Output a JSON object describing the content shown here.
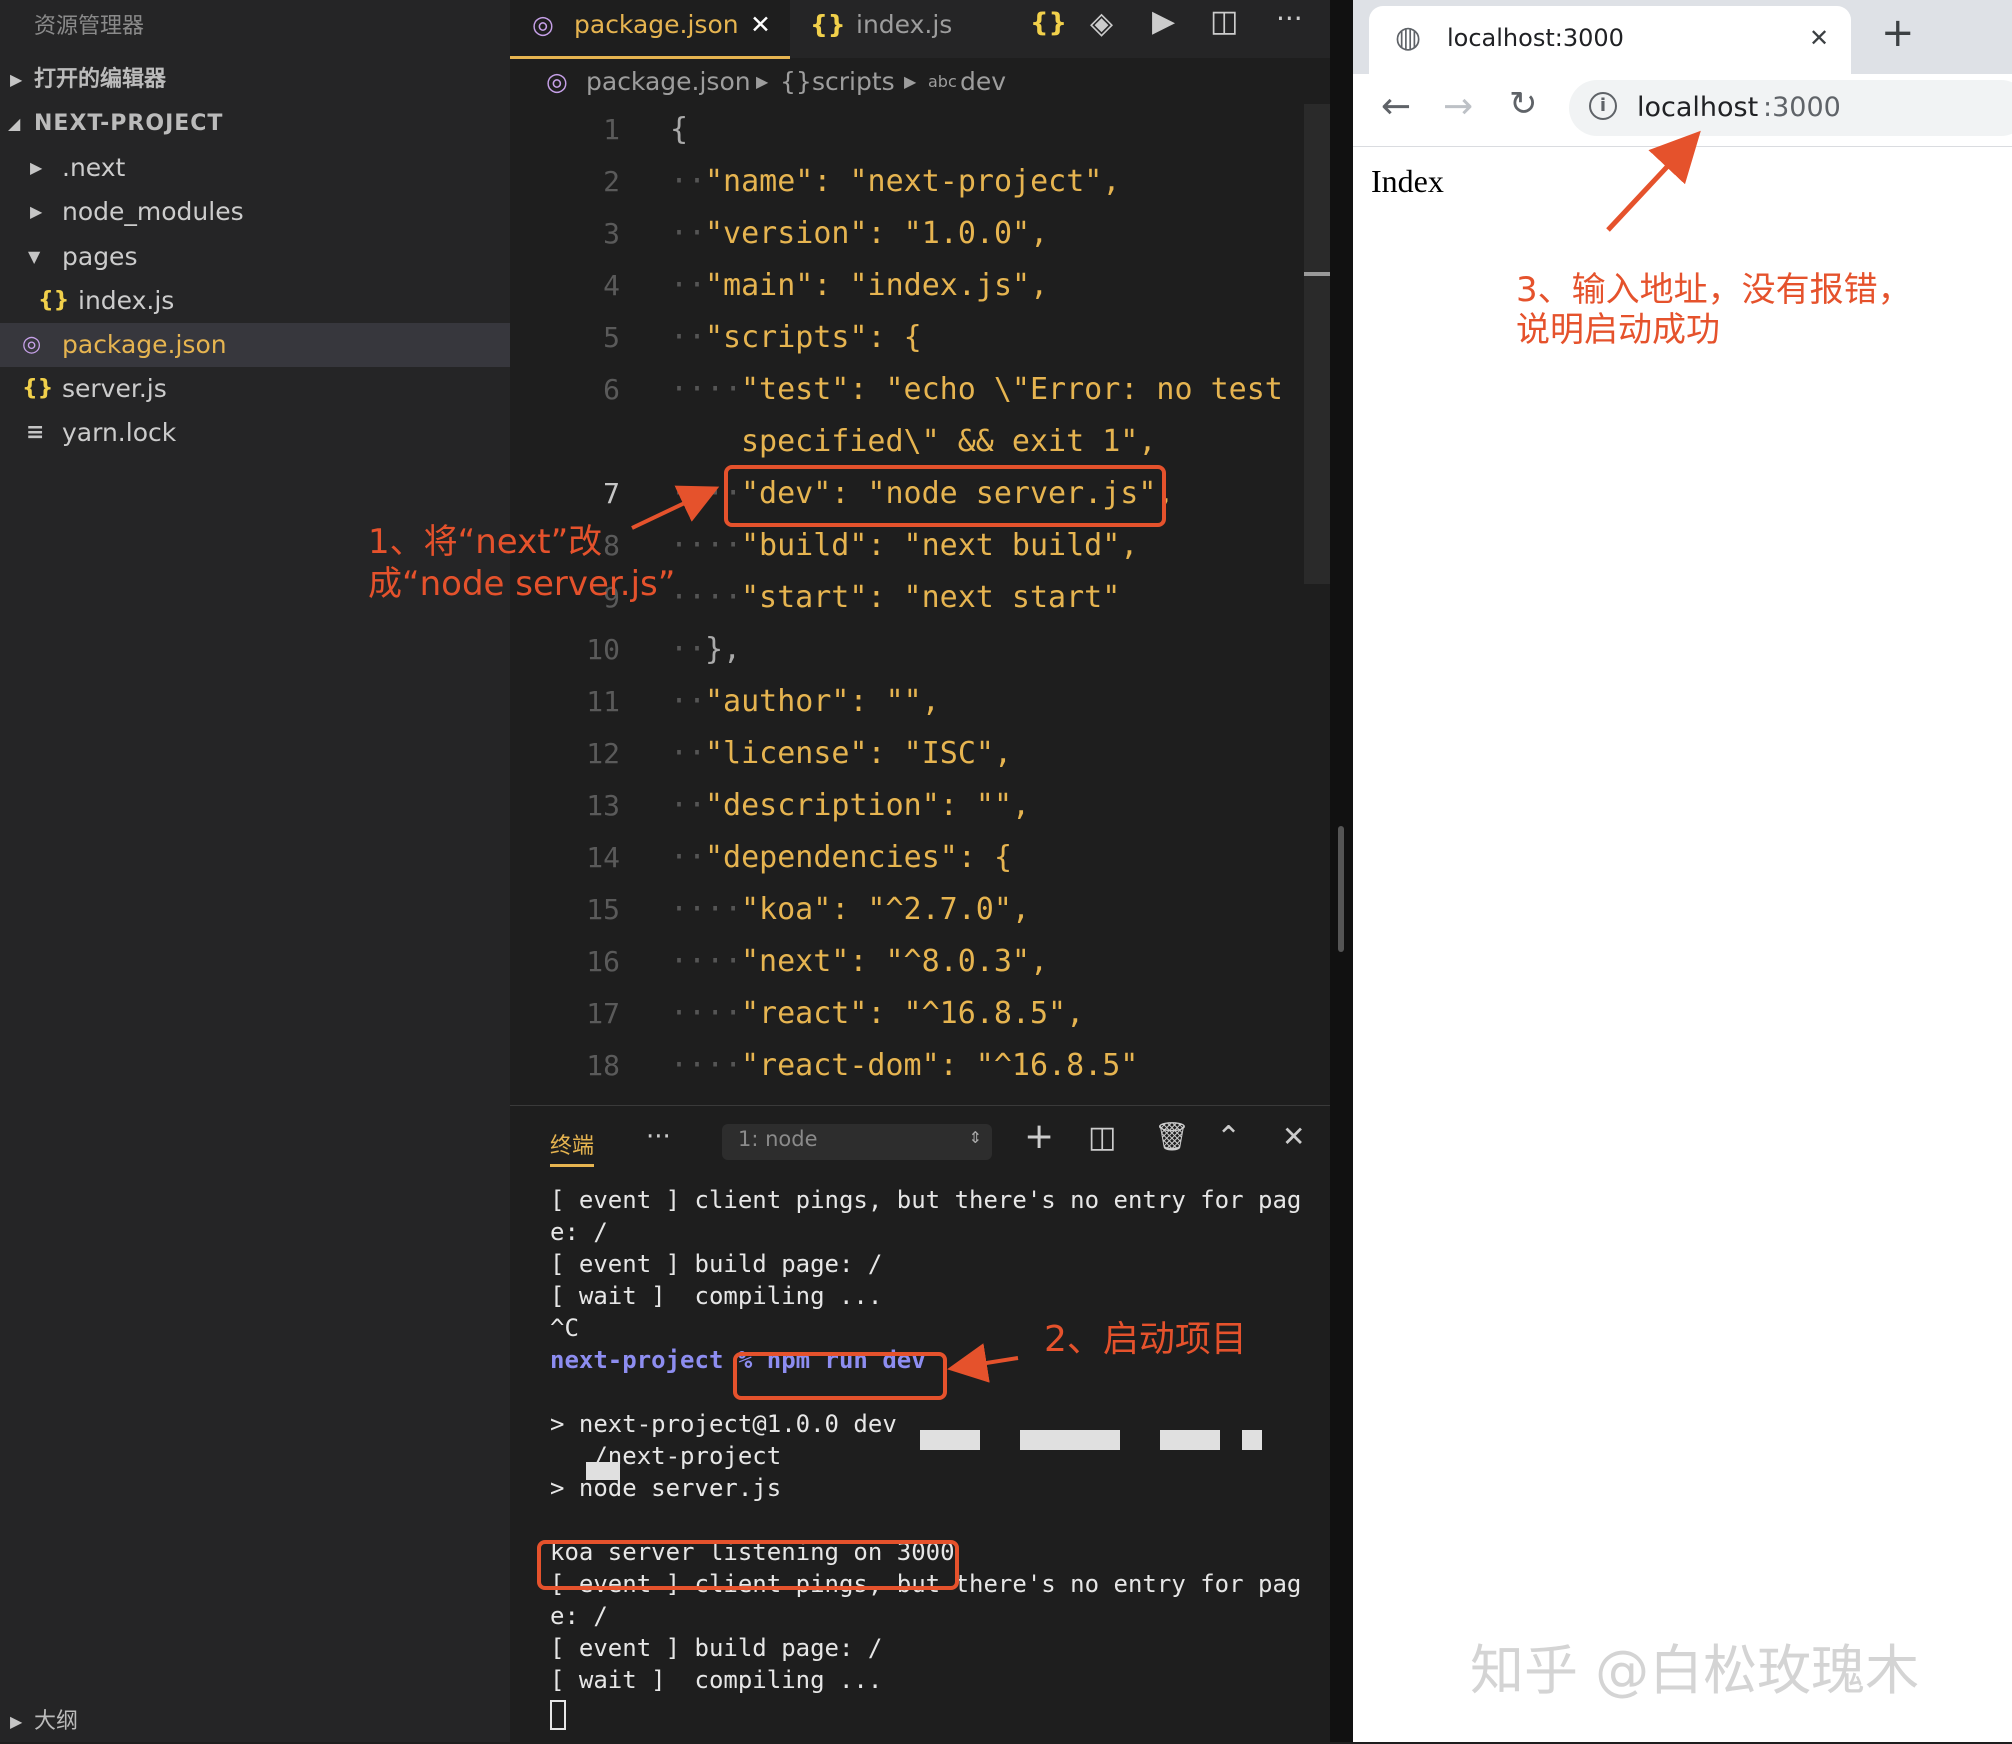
{
  "sidebar": {
    "title": "资源管理器",
    "open_editors": "打开的编辑器",
    "project": "NEXT-PROJECT",
    "items": [
      {
        "label": ".next",
        "type": "folder"
      },
      {
        "label": "node_modules",
        "type": "folder"
      },
      {
        "label": "pages",
        "type": "folder"
      },
      {
        "label": "index.js",
        "type": "file-js"
      },
      {
        "label": "package.json",
        "type": "file-json"
      },
      {
        "label": "server.js",
        "type": "file-js"
      },
      {
        "label": "yarn.lock",
        "type": "file-lock"
      }
    ],
    "outline": "大纲"
  },
  "tabs": [
    {
      "label": "package.json",
      "active": true
    },
    {
      "label": "index.js",
      "active": false
    }
  ],
  "breadcrumb": {
    "file": "package.json",
    "section": "scripts",
    "key": "dev"
  },
  "code": {
    "line_numbers": [
      "1",
      "2",
      "3",
      "4",
      "5",
      "6",
      "7",
      "8",
      "9",
      "10",
      "11",
      "12",
      "13",
      "14",
      "15",
      "16",
      "17",
      "18"
    ],
    "lines": [
      "{",
      "\"name\": \"next-project\",",
      "\"version\": \"1.0.0\",",
      "\"main\": \"index.js\",",
      "\"scripts\": {",
      "\"test\": \"echo \\\"Error: no test",
      "specified\\\" && exit 1\",",
      "\"dev\": \"node server.js\",",
      "\"build\": \"next build\",",
      "\"start\": \"next start\"",
      "},",
      "\"author\": \"\",",
      "\"license\": \"ISC\",",
      "\"description\": \"\",",
      "\"dependencies\": {",
      "\"koa\": \"^2.7.0\",",
      "\"next\": \"^8.0.3\",",
      "\"react\": \"^16.8.5\",",
      "\"react-dom\": \"^16.8.5\""
    ]
  },
  "terminal": {
    "tab_label": "终端",
    "more": "···",
    "select": "1: node",
    "lines": [
      "[ event ] client pings, but there's no entry for pag",
      "e: /",
      "[ event ] build page: /",
      "[ wait ]  compiling ...",
      "^C",
      "next-project % npm run dev",
      "",
      "> next-project@1.0.0 dev",
      "   /next-project",
      "> node server.js",
      "",
      "koa server listening on 3000",
      "[ event ] client pings, but there's no entry for pag",
      "e: /",
      "[ event ] build page: /",
      "[ wait ]  compiling ..."
    ]
  },
  "browser": {
    "tab_title": "localhost:3000",
    "close": "✕",
    "new_tab": "+",
    "url_host": "localhost",
    "url_port": ":3000",
    "page_text": "Index"
  },
  "annotations": {
    "a1_line1": "1、将“next”改",
    "a1_line2": "成“node server.js”",
    "a2": "2、启动项目",
    "a3_line1": "3、输入地址，没有报错，",
    "a3_line2": "说明启动成功"
  },
  "watermark": "知乎 @白松玫瑰木",
  "colors": {
    "accent": "#e5522c",
    "string": "#e6b450",
    "json_icon": "#c6a0e8",
    "js_icon": "#f1d04b"
  }
}
